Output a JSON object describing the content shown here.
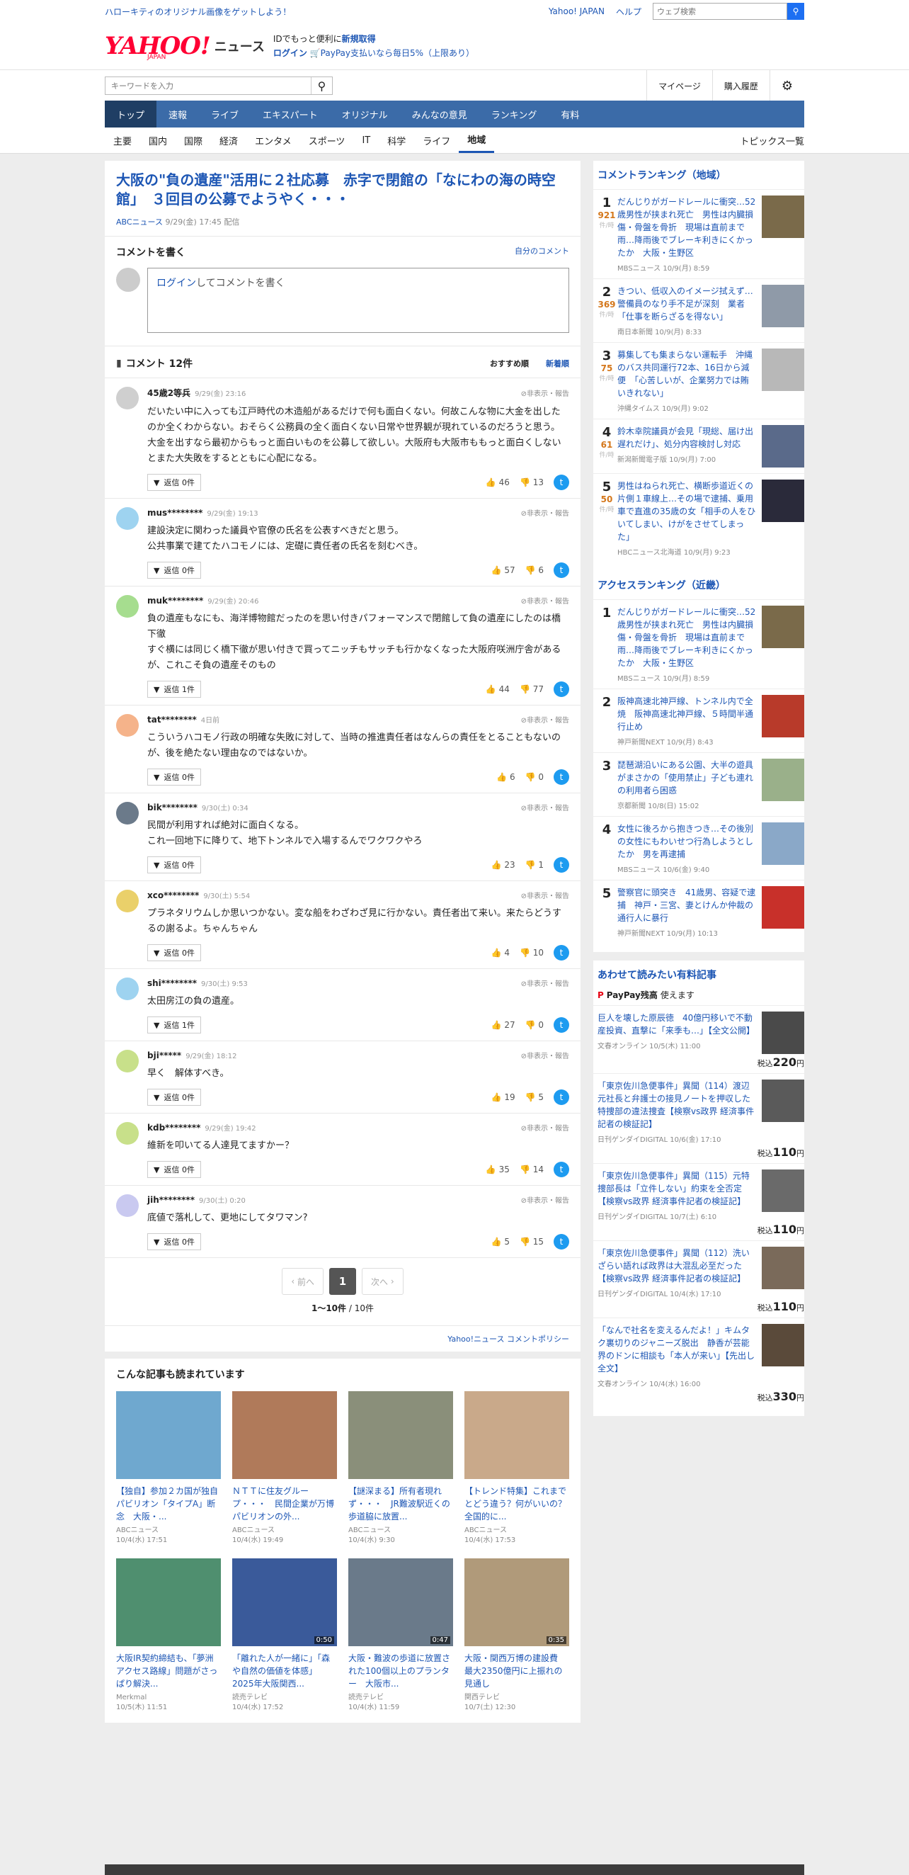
{
  "topbar": {
    "promo": "ハローキティのオリジナル画像をゲットしよう！",
    "yahoo_japan": "Yahoo! JAPAN",
    "help": "ヘルプ",
    "search_placeholder": "ウェブ検索"
  },
  "header": {
    "logo": "YAHOO!",
    "logo_sub": "JAPAN",
    "news": "ニュース",
    "id_text": "IDでもっと便利に",
    "signup": "新規取得",
    "login": "ログイン",
    "paypay": "PayPay支払いなら毎日5%（上限あり）"
  },
  "search": {
    "placeholder": "キーワードを入力",
    "mypage": "マイページ",
    "history": "購入履歴"
  },
  "nav": [
    "トップ",
    "速報",
    "ライブ",
    "エキスパート",
    "オリジナル",
    "みんなの意見",
    "ランキング",
    "有料"
  ],
  "subnav": [
    "主要",
    "国内",
    "国際",
    "経済",
    "エンタメ",
    "スポーツ",
    "IT",
    "科学",
    "ライフ",
    "地域"
  ],
  "subnav_more": "トピックス一覧",
  "article": {
    "title": "大阪の\"負の遺産\"活用に２社応募　赤字で閉館の「なにわの海の時空館」　３回目の公募でようやく・・・",
    "source": "ABCニュース",
    "date": "9/29(金) 17:45 配信"
  },
  "comment_write": {
    "heading": "コメントを書く",
    "own": "自分のコメント",
    "login": "ログイン",
    "box": "してコメントを書く"
  },
  "comments_header": {
    "title": "コメント 12件",
    "sort1": "おすすめ順",
    "sort2": "新着順"
  },
  "report": "非表示・報告",
  "comments": [
    {
      "user": "45歳2等兵",
      "time": "9/29(金) 23:16",
      "text": "だいたい中に入っても江戸時代の木造船があるだけで何も面白くない。何故こんな物に大金を出したのか全くわからない。おそらく公務員の全く面白くない日常や世界観が現れているのだろうと思う。大金を出すなら最初からもっと面白いものを公募して欲しい。大阪府も大阪市ももっと面白くしないとまた大失敗をするとともに心配になる。",
      "reply": "返信 0件",
      "good": "46",
      "bad": "13",
      "color": "#cfcfcf"
    },
    {
      "user": "mus********",
      "time": "9/29(金) 19:13",
      "text": "建設決定に関わった議員や官僚の氏名を公表すべきだと思う。\n公共事業で建てたハコモノには、定礎に責任者の氏名を刻むべき。",
      "reply": "返信 0件",
      "good": "57",
      "bad": "6",
      "color": "#9ed3f0"
    },
    {
      "user": "muk********",
      "time": "9/29(金) 20:46",
      "text": "負の遺産もなにも、海洋博物館だったのを思い付きパフォーマンスで閉館して負の遺産にしたのは橋下徹\nすぐ横には同じく橋下徹が思い付きで買ってニッチもサッチも行かなくなった大阪府咲洲庁舎があるが、これこそ負の遺産そのもの",
      "reply": "返信 1件",
      "good": "44",
      "bad": "77",
      "color": "#a6dd8f"
    },
    {
      "user": "tat********",
      "time": "4日前",
      "text": "こういうハコモノ行政の明確な失敗に対して、当時の推進責任者はなんらの責任をとることもないのが、後を絶たない理由なのではないか。",
      "reply": "返信 0件",
      "good": "6",
      "bad": "0",
      "color": "#f5b38a"
    },
    {
      "user": "bik********",
      "time": "9/30(土) 0:34",
      "text": "民間が利用すれば絶対に面白くなる。\nこれ一回地下に降りて、地下トンネルで入場するんでワクワクやろ",
      "reply": "返信 0件",
      "good": "23",
      "bad": "1",
      "color": "#6b7a8a"
    },
    {
      "user": "xco********",
      "time": "9/30(土) 5:54",
      "text": "プラネタリウムしか思いつかない。変な船をわざわざ見に行かない。責任者出て来い。来たらどうするの謝るよ。ちゃんちゃん",
      "reply": "返信 0件",
      "good": "4",
      "bad": "10",
      "color": "#ead06a"
    },
    {
      "user": "shi********",
      "time": "9/30(土) 9:53",
      "text": "太田房江の負の遺産。",
      "reply": "返信 1件",
      "good": "27",
      "bad": "0",
      "color": "#9ed3f0"
    },
    {
      "user": "bji*****",
      "time": "9/29(金) 18:12",
      "text": "早く　解体すべき。",
      "reply": "返信 0件",
      "good": "19",
      "bad": "5",
      "color": "#c8e08a"
    },
    {
      "user": "kdb********",
      "time": "9/29(金) 19:42",
      "text": "維新を叩いてる人達見てますかー？",
      "reply": "返信 0件",
      "good": "35",
      "bad": "14",
      "color": "#c8e08a"
    },
    {
      "user": "jih********",
      "time": "9/30(土) 0:20",
      "text": "底値で落札して、更地にしてタワマン?",
      "reply": "返信 0件",
      "good": "5",
      "bad": "15",
      "color": "#c9c9f0"
    }
  ],
  "pager": {
    "prev": "前へ",
    "page": "1",
    "next": "次へ",
    "count_bold": "1〜10件",
    "count_rest": " / 10件"
  },
  "policy": "Yahoo!ニュース コメントポリシー",
  "related": {
    "heading": "こんな記事も読まれています",
    "items": [
      {
        "title": "【独自】参加２カ国が独自パビリオン「タイプA」断念　大阪・...",
        "source": "ABCニュース",
        "date": "10/4(水) 17:51",
        "color": "#6fa8cf"
      },
      {
        "title": "ＮＴＴに住友グループ・・・　民間企業が万博パビリオンの外...",
        "source": "ABCニュース",
        "date": "10/4(水) 19:49",
        "color": "#b07a5a"
      },
      {
        "title": "【謎深まる】所有者現れず・・・　JR難波駅近くの歩道脇に放置...",
        "source": "ABCニュース",
        "date": "10/4(水) 9:30",
        "color": "#8a8f7a"
      },
      {
        "title": "【トレンド特集】これまでとどう違う？何がいいの？　全国的に...",
        "source": "ABCニュース",
        "date": "10/4(水) 17:53",
        "color": "#c9a98a"
      },
      {
        "title": "大阪IR契約締結も、「夢洲アクセス路線」問題がさっぱり解決...",
        "source": "Merkmal",
        "date": "10/5(木) 11:51",
        "color": "#4f8f6f",
        "dur": ""
      },
      {
        "title": "「離れた人が一緒に」「森や自然の価値を体感」2025年大阪関西...",
        "source": "読売テレビ",
        "date": "10/4(水) 17:52",
        "color": "#3a5a9a",
        "dur": "0:50"
      },
      {
        "title": "大阪・難波の歩道に放置された100個以上のプランター　大阪市...",
        "source": "読売テレビ",
        "date": "10/4(水) 11:59",
        "color": "#6a7a8a",
        "dur": "0:47"
      },
      {
        "title": "大阪・関西万博の建設費　最大2350億円に上振れの見通し",
        "source": "関西テレビ",
        "date": "10/7(土) 12:30",
        "color": "#b09a7a",
        "dur": "0:35"
      }
    ]
  },
  "ranking": {
    "heading": "コメントランキング（地域）",
    "count_label": "件/時",
    "items": [
      {
        "n": "1",
        "c": "921",
        "title": "だんじりがガードレールに衝突…52歳男性が挟まれ死亡　男性は内臓損傷・骨盤を骨折　現場は直前まで雨…降雨後でブレーキ利きにくかったか　大阪・生野区",
        "src": "MBSニュース 10/9(月) 8:59",
        "color": "#7a6a4a"
      },
      {
        "n": "2",
        "c": "369",
        "title": "きつい、低収入のイメージ拭えず…警備員のなり手不足が深刻　業者「仕事を断らざるを得ない」",
        "src": "南日本新聞 10/9(月) 8:33",
        "color": "#8f9aa8"
      },
      {
        "n": "3",
        "c": "75",
        "title": "募集しても集まらない運転手　沖縄のバス共同運行72本、16日から減便　「心苦しいが、企業努力では賄いきれない」",
        "src": "沖縄タイムス 10/9(月) 9:02",
        "color": "#b8b8b8"
      },
      {
        "n": "4",
        "c": "61",
        "title": "鈴木幸院議員が会見「現総、届け出遅れだけ」、処分内容検討し対応",
        "src": "新潟新聞電子版 10/9(月) 7:00",
        "color": "#5a6a8a"
      },
      {
        "n": "5",
        "c": "50",
        "title": "男性はねられ死亡、横断歩道近くの片側１車線上…その場で逮捕、乗用車で直進の35歳の女「相手の人をひいてしまい、けがをさせてしまった」",
        "src": "HBCニュース北海道 10/9(月) 9:23",
        "color": "#2a2a3a"
      }
    ]
  },
  "access": {
    "heading": "アクセスランキング（近畿）",
    "items": [
      {
        "n": "1",
        "title": "だんじりがガードレールに衝突…52歳男性が挟まれ死亡　男性は内臓損傷・骨盤を骨折　現場は直前まで雨…降雨後でブレーキ利きにくかったか　大阪・生野区",
        "src": "MBSニュース 10/9(月) 8:59",
        "color": "#7a6a4a"
      },
      {
        "n": "2",
        "title": "阪神高速北神戸線、トンネル内で全焼　阪神高速北神戸線、５時間半通行止め",
        "src": "神戸新聞NEXT 10/9(月) 8:43",
        "color": "#b83a2a"
      },
      {
        "n": "3",
        "title": "琵琶湖沿いにある公園、大半の遊具がまさかの「使用禁止」子ども連れの利用者ら困惑",
        "src": "京都新聞 10/8(日) 15:02",
        "color": "#9ab08a"
      },
      {
        "n": "4",
        "title": "女性に後ろから抱きつき…その後別の女性にもわいせつ行為しようとしたか　男を再逮捕",
        "src": "MBSニュース 10/6(金) 9:40",
        "color": "#8aa8c8"
      },
      {
        "n": "5",
        "title": "警察官に頭突き　41歳男、容疑で逮捕　神戸・三宮、妻とけんか仲裁の通行人に暴行",
        "src": "神戸新聞NEXT 10/9(月) 10:13",
        "color": "#c8302a"
      }
    ]
  },
  "paid": {
    "heading": "あわせて読みたい有料記事",
    "paypay": "PayPay残高",
    "usable": "使えます",
    "tax": "税込",
    "yen": "円",
    "items": [
      {
        "title": "巨人を壊した原辰徳　40億円移いで不動産投資、直撃に「来季も…」【全文公開】",
        "src": "文春オンライン 10/5(木) 11:00",
        "price": "220",
        "color": "#4a4a4a"
      },
      {
        "title": "「東京佐川急便事件」異聞（114）渡辺元社長と弁護士の接見ノートを押収した特捜部の違法捜査【検察vs政界 経済事件記者の検証記】",
        "src": "日刊ゲンダイDIGITAL 10/6(金) 17:10",
        "price": "110",
        "color": "#5a5a5a"
      },
      {
        "title": "「東京佐川急便事件」異聞（115）元特捜部長は「立件しない」約束を全否定【検察vs政界 経済事件記者の検証記】",
        "src": "日刊ゲンダイDIGITAL 10/7(土) 6:10",
        "price": "110",
        "color": "#6a6a6a"
      },
      {
        "title": "「東京佐川急便事件」異聞（112）洗いざらい語れば政界は大混乱必至だった【検察vs政界 経済事件記者の検証記】",
        "src": "日刊ゲンダイDIGITAL 10/4(水) 17:10",
        "price": "110",
        "color": "#7a6a5a"
      },
      {
        "title": "「なんで社名を変えるんだよ！」キムタク裏切りのジャニーズ脱出　静香が芸能界のドンに相談も「本人が来い」【先出し全文】",
        "src": "文春オンライン 10/4(水) 16:00",
        "price": "330",
        "color": "#5a4a3a"
      }
    ]
  }
}
